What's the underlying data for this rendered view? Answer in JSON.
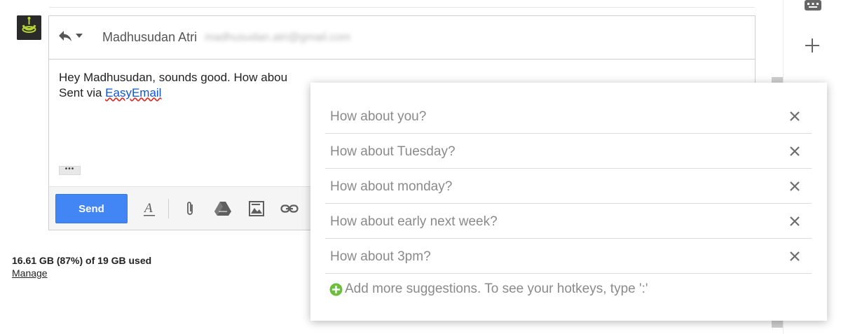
{
  "reply": {
    "recipient_name": "Madhusudan Atri",
    "recipient_email": "madhusudan.atri@gmail.com",
    "body_line1": "Hey Madhusudan, sounds good. How abou",
    "signature_prefix": "Sent via ",
    "signature_link": "EasyEmail",
    "quoted_toggle": "•••",
    "send_label": "Send"
  },
  "toolbar_icons": [
    "text-format-icon",
    "attachment-icon",
    "drive-icon",
    "photo-icon",
    "link-icon"
  ],
  "storage": {
    "usage_text": "16.61 GB (87%) of 19 GB used",
    "manage_label": "Manage"
  },
  "suggestions": {
    "items": [
      "How about you?",
      "How about Tuesday?",
      "How about monday?",
      "How about early next week?",
      "How about 3pm?"
    ],
    "add_more_label": "Add more suggestions. To see your hotkeys, type ':'"
  },
  "colors": {
    "send_button": "#4285f4",
    "link": "#1155cc",
    "add_icon": "#6abf3c",
    "avatar_ring": "#b5d334"
  },
  "side_icons": [
    "keyboard-icon",
    "plus-icon"
  ]
}
